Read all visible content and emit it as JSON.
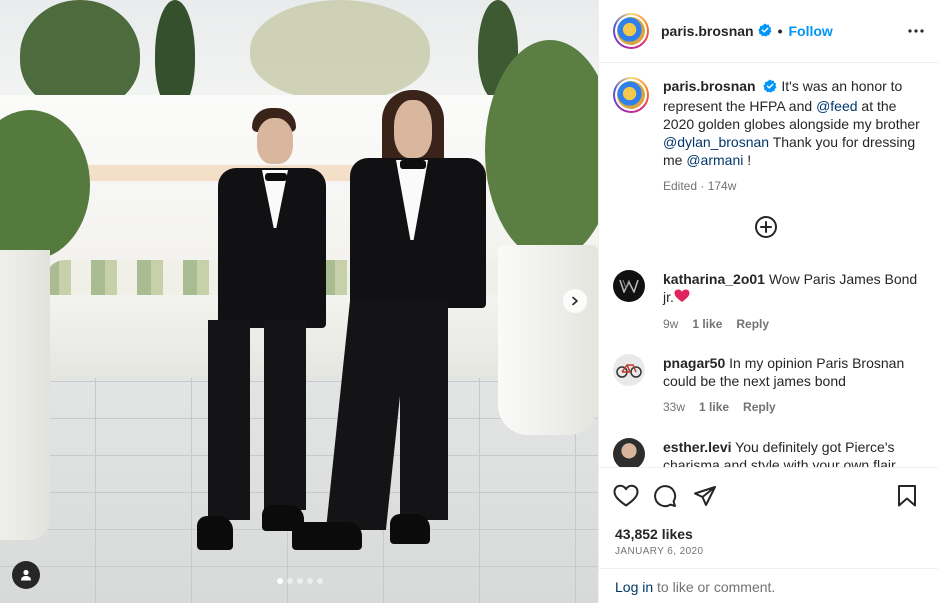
{
  "post": {
    "author": {
      "username": "paris.brosnan",
      "verified_icon": "verified-badge-icon",
      "separator": "•",
      "follow_label": "Follow"
    },
    "caption": {
      "username": "paris.brosnan",
      "parts": {
        "t1": "It's was an honor to represent the HFPA and ",
        "m1": "@feed",
        "t2": " at the 2020 golden globes alongside my brother ",
        "m2": "@dylan_brosnan",
        "t3": " Thank you for dressing me ",
        "m3": "@armani",
        "t4": " !"
      },
      "meta": "Edited · 174w"
    },
    "comments": [
      {
        "username": "katharina_2o01",
        "text": "Wow Paris James Bond jr.",
        "emoji": "red-heart-icon",
        "age": "9w",
        "likes": "1 like",
        "reply": "Reply"
      },
      {
        "username": "pnagar50",
        "text": "In my opinion Paris Brosnan could be the next james bond",
        "age": "33w",
        "likes": "1 like",
        "reply": "Reply"
      },
      {
        "username": "esther.levi",
        "text": "You definitely got Pierce's charisma and style with your own flair"
      }
    ],
    "likes": "43,852 likes",
    "date": "JANUARY 6, 2020",
    "login": {
      "link": "Log in",
      "rest": " to like or comment."
    },
    "carousel": {
      "count": 5,
      "active": 0
    },
    "colors": {
      "accent": "#0095f6",
      "mention": "#00376b",
      "muted": "#737373",
      "text": "#262626"
    }
  }
}
